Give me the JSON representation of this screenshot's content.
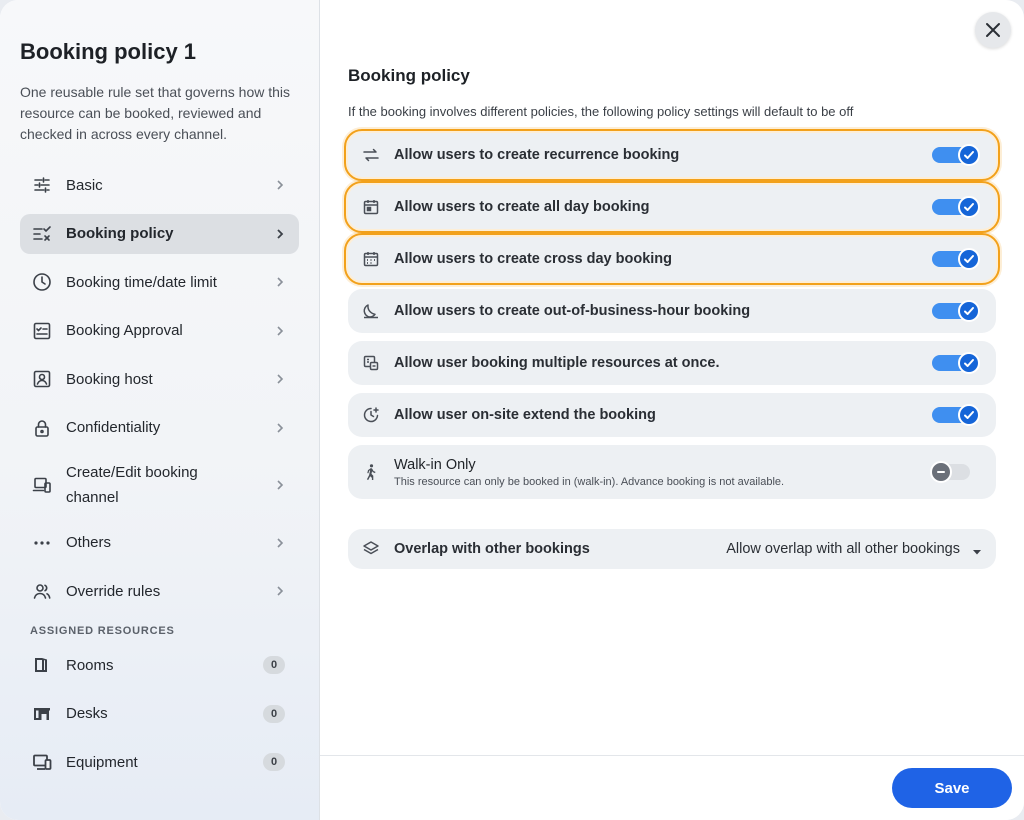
{
  "sidebar": {
    "title": "Booking policy 1",
    "description": "One reusable rule set that governs how this resource can be booked, reviewed and checked in across every channel.",
    "items": [
      {
        "label": "Basic",
        "icon": "sliders-icon"
      },
      {
        "label": "Booking policy",
        "icon": "list-check-icon",
        "active": true
      },
      {
        "label": "Booking time/date limit",
        "icon": "clock-icon"
      },
      {
        "label": "Booking Approval",
        "icon": "approval-icon"
      },
      {
        "label": "Booking host",
        "icon": "host-icon"
      },
      {
        "label": "Confidentiality",
        "icon": "lock-icon"
      },
      {
        "label": "Create/Edit booking channel",
        "icon": "devices-icon"
      },
      {
        "label": "Others",
        "icon": "more-icon"
      },
      {
        "label": "Override rules",
        "icon": "users-icon"
      }
    ],
    "resources_label": "ASSIGNED RESOURCES",
    "resources": [
      {
        "label": "Rooms",
        "count": "0",
        "icon": "door-icon"
      },
      {
        "label": "Desks",
        "count": "0",
        "icon": "desk-icon"
      },
      {
        "label": "Equipment",
        "count": "0",
        "icon": "equipment-icon"
      }
    ]
  },
  "main": {
    "title": "Booking policy",
    "description": "If the booking involves different policies, the following policy settings will default to be off",
    "settings": [
      {
        "label": "Allow users to create recurrence booking",
        "on": true,
        "icon": "repeat-icon"
      },
      {
        "label": "Allow users to create all day booking",
        "on": true,
        "icon": "calendar-day-icon"
      },
      {
        "label": "Allow users to create cross day booking",
        "on": true,
        "icon": "calendar-icon"
      },
      {
        "label": "Allow users to create out-of-business-hour booking",
        "on": true,
        "icon": "moon-icon"
      },
      {
        "label": "Allow user booking multiple resources at once.",
        "on": true,
        "icon": "multi-resource-icon"
      },
      {
        "label": "Allow user on-site extend the booking",
        "on": true,
        "icon": "clock-plus-icon"
      }
    ],
    "walkin": {
      "label": "Walk-in Only",
      "sub": "This resource can only be booked in (walk-in). Advance booking is not available.",
      "on": false,
      "icon": "walking-icon"
    },
    "overlap": {
      "label": "Overlap with other bookings",
      "value": "Allow overlap with all other bookings",
      "icon": "layers-icon"
    }
  },
  "footer": {
    "save_label": "Save"
  },
  "colors": {
    "accent": "#1f63e6",
    "highlight": "#f2a11b",
    "toggle_on": "#3f8ff0"
  }
}
